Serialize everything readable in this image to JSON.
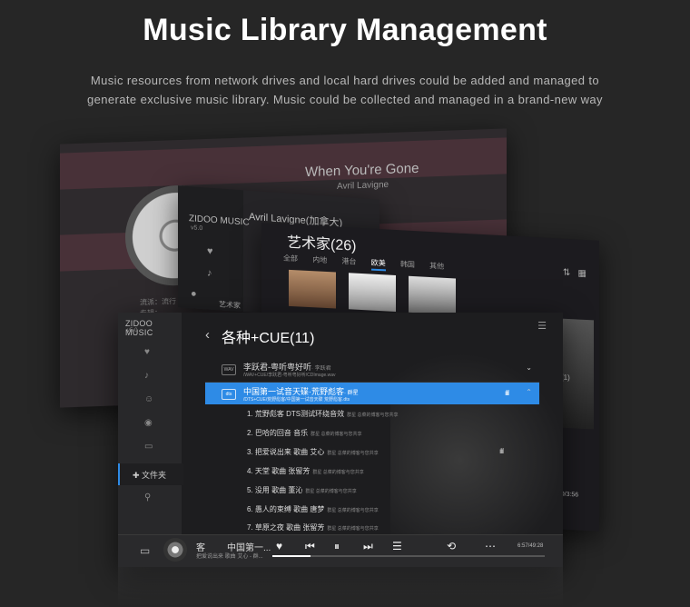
{
  "hero": {
    "title": "Music Library Management",
    "subtitle_line1": "Music resources from network drives and local hard drives could be added and managed to",
    "subtitle_line2": "generate exclusive music library. Music could be collected and managed in a brand-new way"
  },
  "now_playing_window": {
    "song": "When You're Gone",
    "artist": "Avril Lavigne",
    "meta": "流派：流行\n专辑：..."
  },
  "artist_window": {
    "logo": "ZIDOO MUSIC",
    "version": "v5.0",
    "artist": "Avril Lavigne(加拿大)",
    "label": "艺术家"
  },
  "artists_window": {
    "title": "艺术家(26)",
    "tabs": [
      "全部",
      "内地",
      "港台",
      "欧美",
      "韩国",
      "其他"
    ],
    "active_tab": "欧美",
    "sort_icon": "⇅",
    "grid_icon": "▦",
    "count_badge": "(1)",
    "time": "1:10/3:56"
  },
  "main": {
    "logo": "ZIDOO MUSIC",
    "version": "v5.0",
    "sidebar": {
      "icons": [
        "heart-icon",
        "microphone-icon",
        "person-icon",
        "disc-icon",
        "folder-icon"
      ],
      "selected_label": "✚ 文件夹",
      "search_icon": "search-icon"
    },
    "back_symbol": "‹",
    "page_title": "各种+CUE(11)",
    "list_icon": "☰",
    "items": [
      {
        "badge": "WAV",
        "title": "李跃君-粤听粤好听",
        "artist": "· 李跃君",
        "path": "/WAV+CUE/李跃君-粤听粤好听/CDImage.wav",
        "right": "⌄"
      },
      {
        "badge": "dts",
        "title": "中国第一试音天碟·荒野彪客",
        "artist": "· 群星",
        "path": "/DTS+CUE/荒野彪客/中国第一试音天碟 荒野彪客.dts",
        "right": "⌃",
        "eq": "ılıl"
      }
    ],
    "tracks": [
      {
        "label": "1. 荒野彪客 DTS测试环绕音效",
        "sub": "群星 总菜的博客与您共享"
      },
      {
        "label": "2. 巴哈的回音 音乐",
        "sub": "群星 总菜的博客与您共享"
      },
      {
        "label": "3. 把爱说出来 歌曲 艾心",
        "sub": "群星 总菜的博客与您共享"
      },
      {
        "label": "4. 天堂 歌曲 张留芳",
        "sub": "群星 总菜的博客与您共享"
      },
      {
        "label": "5. 没用 歌曲 董沁",
        "sub": "群星 总菜的博客与您共享"
      },
      {
        "label": "6. 愚人的束缚 歌曲 唐梦",
        "sub": "群星 总菜的博客与您共享"
      },
      {
        "label": "7. 草原之夜 歌曲 张留芳",
        "sub": "群星 总菜的博客与您共享"
      }
    ],
    "playing_eq": "ılıl",
    "player": {
      "screen_icon": "▭",
      "title_a": "客",
      "title_b": "中国第一...",
      "sub_a": "把爱说出来 歌曲 艾心 - 群...",
      "sub_b": "",
      "time": "6:57/49:28",
      "progress": 0.14
    }
  }
}
